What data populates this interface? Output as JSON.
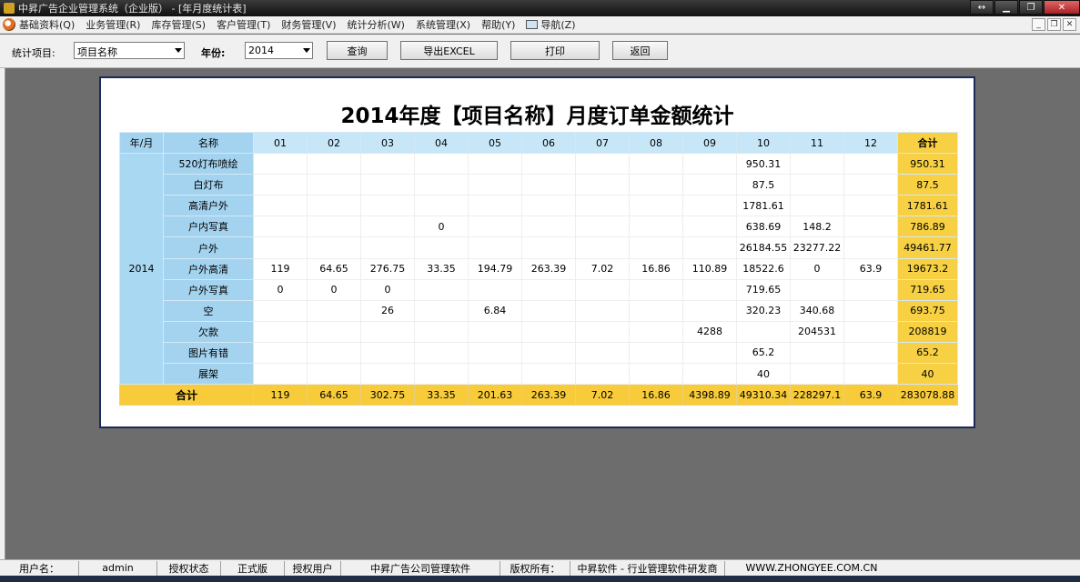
{
  "window": {
    "title": "中昇广告企业管理系统（企业版） - [年月度统计表]"
  },
  "menu": {
    "items": [
      "基础资料(Q)",
      "业务管理(R)",
      "库存管理(S)",
      "客户管理(T)",
      "财务管理(V)",
      "统计分析(W)",
      "系统管理(X)",
      "帮助(Y)"
    ],
    "nav": "导航(Z)"
  },
  "toolbar": {
    "stat_label": "统计项目:",
    "stat_value": "项目名称",
    "year_label": "年份:",
    "year_value": "2014",
    "query_label": "查询",
    "export_label": "导出EXCEL",
    "print_label": "打印",
    "back_label": "返回"
  },
  "report": {
    "title": "2014年度【项目名称】月度订单金额统计",
    "year_header": "年/月",
    "name_header": "名称",
    "total_header": "合计",
    "months": [
      "01",
      "02",
      "03",
      "04",
      "05",
      "06",
      "07",
      "08",
      "09",
      "10",
      "11",
      "12"
    ],
    "year": "2014",
    "rows": [
      {
        "name": "520灯布喷绘",
        "values": [
          "",
          "",
          "",
          "",
          "",
          "",
          "",
          "",
          "",
          "950.31",
          "",
          ""
        ],
        "total": "950.31"
      },
      {
        "name": "白灯布",
        "values": [
          "",
          "",
          "",
          "",
          "",
          "",
          "",
          "",
          "",
          "87.5",
          "",
          ""
        ],
        "total": "87.5"
      },
      {
        "name": "高清户外",
        "values": [
          "",
          "",
          "",
          "",
          "",
          "",
          "",
          "",
          "",
          "1781.61",
          "",
          ""
        ],
        "total": "1781.61"
      },
      {
        "name": "户内写真",
        "values": [
          "",
          "",
          "",
          "0",
          "",
          "",
          "",
          "",
          "",
          "638.69",
          "148.2",
          ""
        ],
        "total": "786.89"
      },
      {
        "name": "户外",
        "values": [
          "",
          "",
          "",
          "",
          "",
          "",
          "",
          "",
          "",
          "26184.55",
          "23277.22",
          ""
        ],
        "total": "49461.77"
      },
      {
        "name": "户外高清",
        "values": [
          "119",
          "64.65",
          "276.75",
          "33.35",
          "194.79",
          "263.39",
          "7.02",
          "16.86",
          "110.89",
          "18522.6",
          "0",
          "63.9"
        ],
        "total": "19673.2"
      },
      {
        "name": "户外写真",
        "values": [
          "0",
          "0",
          "0",
          "",
          "",
          "",
          "",
          "",
          "",
          "719.65",
          "",
          ""
        ],
        "total": "719.65"
      },
      {
        "name": "空",
        "values": [
          "",
          "",
          "26",
          "",
          "6.84",
          "",
          "",
          "",
          "",
          "320.23",
          "340.68",
          ""
        ],
        "total": "693.75"
      },
      {
        "name": "欠款",
        "values": [
          "",
          "",
          "",
          "",
          "",
          "",
          "",
          "",
          "4288",
          "",
          "204531",
          ""
        ],
        "total": "208819"
      },
      {
        "name": "图片有错",
        "values": [
          "",
          "",
          "",
          "",
          "",
          "",
          "",
          "",
          "",
          "65.2",
          "",
          ""
        ],
        "total": "65.2"
      },
      {
        "name": "展架",
        "values": [
          "",
          "",
          "",
          "",
          "",
          "",
          "",
          "",
          "",
          "40",
          "",
          ""
        ],
        "total": "40"
      }
    ],
    "grand_total": {
      "label": "合计",
      "values": [
        "119",
        "64.65",
        "302.75",
        "33.35",
        "201.63",
        "263.39",
        "7.02",
        "16.86",
        "4398.89",
        "49310.34",
        "228297.1",
        "63.9"
      ],
      "total": "283078.88"
    }
  },
  "status": {
    "user_label": "用户名：",
    "user_value": "admin",
    "license_label": "授权状态",
    "license_value": "正式版",
    "licensee_label": "授权用户",
    "licensee_value": "中昇广告公司管理软件",
    "copyright_label": "版权所有：",
    "copyright_value": "中昇软件 - 行业管理软件研发商",
    "website": "WWW.ZHONGYEE.COM.CN"
  }
}
